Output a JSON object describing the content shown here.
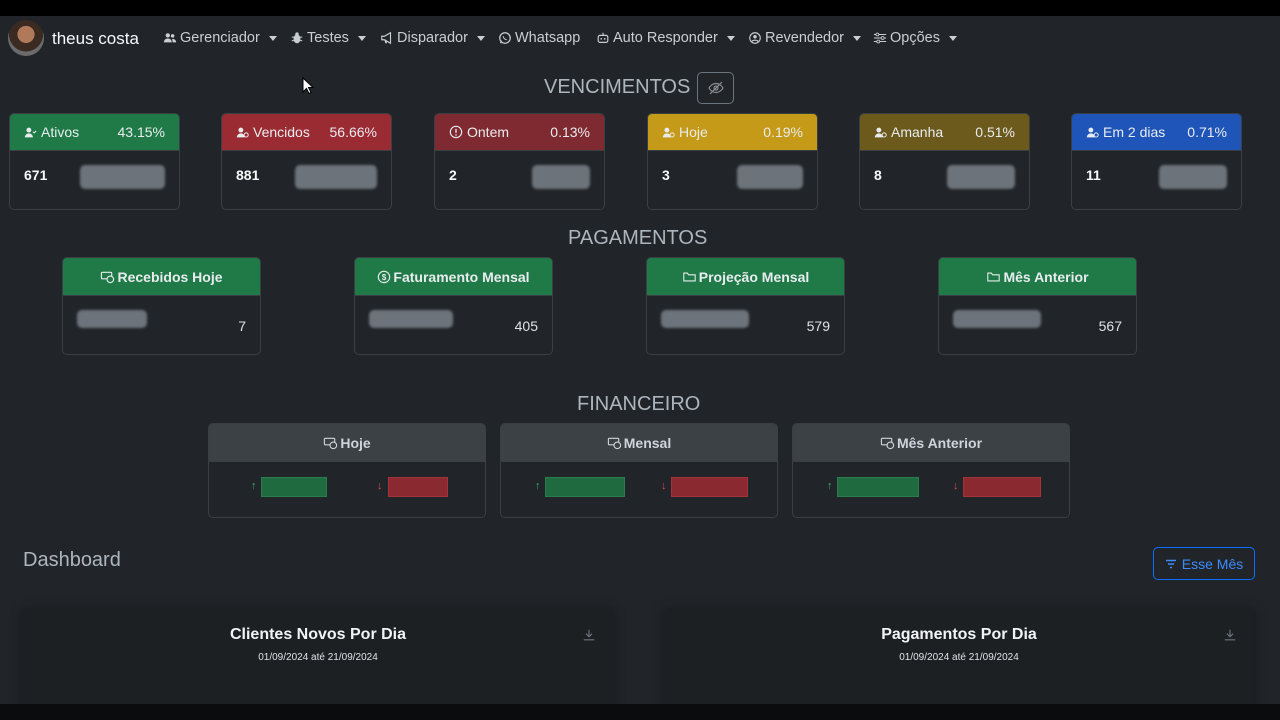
{
  "navbar": {
    "brand": "theus costa",
    "items": [
      {
        "label": "Gerenciador",
        "icon": "users-icon"
      },
      {
        "label": "Testes",
        "icon": "bug-icon"
      },
      {
        "label": "Disparador",
        "icon": "megaphone-icon"
      },
      {
        "label": "Whatsapp",
        "icon": "whatsapp-icon"
      },
      {
        "label": "Auto Responder",
        "icon": "robot-icon"
      },
      {
        "label": "Revendedor",
        "icon": "reseller-icon"
      },
      {
        "label": "Opções",
        "icon": "sliders-icon"
      }
    ]
  },
  "vencimentos": {
    "title": "VENCIMENTOS",
    "cards": [
      {
        "label": "Ativos",
        "percent": "43.15%",
        "count": "671",
        "color": "#1f7a47"
      },
      {
        "label": "Vencidos",
        "percent": "56.66%",
        "count": "881",
        "color": "#9b2b33"
      },
      {
        "label": "Ontem",
        "percent": "0.13%",
        "count": "2",
        "color": "#7f2a30"
      },
      {
        "label": "Hoje",
        "percent": "0.19%",
        "count": "3",
        "color": "#c49a18"
      },
      {
        "label": "Amanha",
        "percent": "0.51%",
        "count": "8",
        "color": "#6b5a1c"
      },
      {
        "label": "Em 2 dias",
        "percent": "0.71%",
        "count": "11",
        "color": "#1f55b8"
      }
    ]
  },
  "pagamentos": {
    "title": "PAGAMENTOS",
    "cards": [
      {
        "label": "Recebidos Hoje",
        "value": "7"
      },
      {
        "label": "Faturamento Mensal",
        "value": "405"
      },
      {
        "label": "Projeção Mensal",
        "value": "579"
      },
      {
        "label": "Mês Anterior",
        "value": "567"
      }
    ]
  },
  "financeiro": {
    "title": "FINANCEIRO",
    "cards": [
      {
        "label": "Hoje",
        "up": "↑",
        "down": "↓"
      },
      {
        "label": "Mensal",
        "up": "↑",
        "down": "↓"
      },
      {
        "label": "Mês Anterior",
        "up": "↑",
        "down": "↓"
      }
    ]
  },
  "dashboard": {
    "title": "Dashboard",
    "filter_label": "Esse Mês",
    "panels": [
      {
        "title": "Clientes Novos Por Dia",
        "date": "01/09/2024 até 21/09/2024"
      },
      {
        "title": "Pagamentos Por Dia",
        "date": "01/09/2024 até 21/09/2024"
      }
    ]
  }
}
